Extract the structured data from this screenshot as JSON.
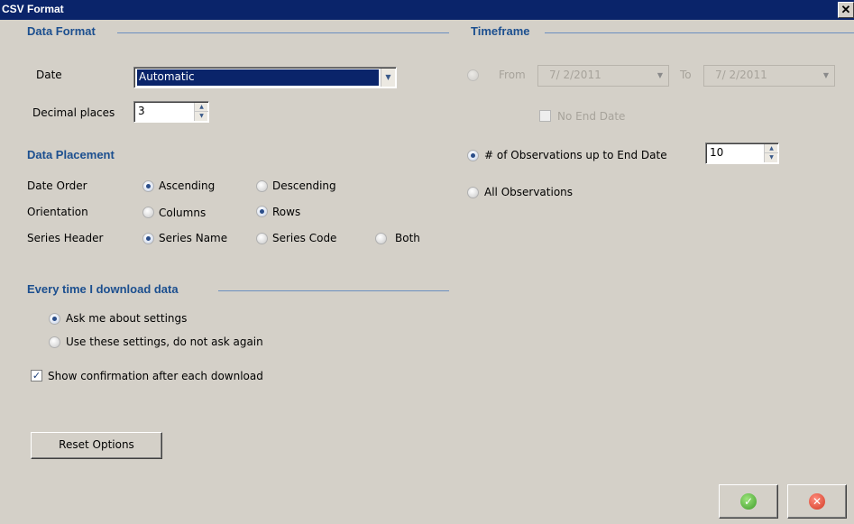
{
  "window": {
    "title": "CSV Format",
    "close_glyph": "✕"
  },
  "data_format": {
    "title": "Data Format",
    "date_label": "Date",
    "date_value": "Automatic",
    "decimal_label": "Decimal places",
    "decimal_value": "3"
  },
  "timeframe": {
    "title": "Timeframe",
    "from_label": "From",
    "from_value": "7/ 2/2011",
    "to_label": "To",
    "to_value": "7/ 2/2011",
    "no_end_date_label": "No End Date",
    "observations_label": "# of Observations up to End Date",
    "observations_value": "10",
    "all_observations_label": "All Observations"
  },
  "placement": {
    "title": "Data Placement",
    "date_order_label": "Date Order",
    "ascending": "Ascending",
    "descending": "Descending",
    "orientation_label": "Orientation",
    "columns": "Columns",
    "rows": "Rows",
    "series_header_label": "Series Header",
    "series_name": "Series Name",
    "series_code": "Series Code",
    "both": "Both"
  },
  "download": {
    "title": "Every time I download data",
    "ask_label": "Ask me about settings",
    "use_label": "Use these settings, do not ask again",
    "confirm_label": "Show confirmation after each download"
  },
  "buttons": {
    "reset": "Reset Options",
    "ok_glyph": "✓",
    "cancel_glyph": "✕"
  },
  "colors": {
    "title_bar": "#0a246a",
    "section_title": "#1c4f8f",
    "dialog_bg": "#d4d0c8"
  }
}
